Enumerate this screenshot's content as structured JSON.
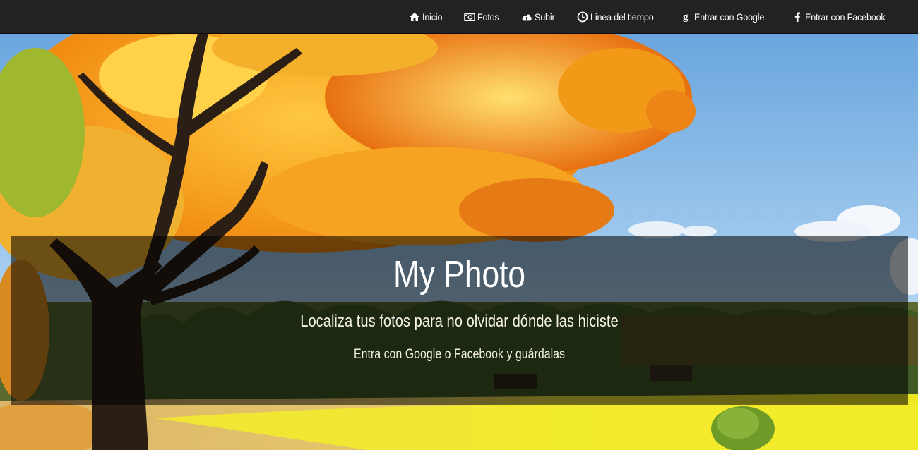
{
  "navbar": {
    "items": [
      {
        "label": "Inicio",
        "icon": "home-icon"
      },
      {
        "label": "Fotos",
        "icon": "camera-icon"
      },
      {
        "label": "Subir",
        "icon": "cloud-upload-icon"
      },
      {
        "label": "Linea del tiempo",
        "icon": "clock-icon"
      },
      {
        "label": "Entrar con Google",
        "icon": "google-plus-icon"
      },
      {
        "label": "Entrar con Facebook",
        "icon": "facebook-icon"
      }
    ]
  },
  "hero": {
    "title": "My Photo",
    "subtitle": "Localiza tus fotos para no olvidar dónde las hiciste",
    "cta": "Entra con Google o Facebook y guárdalas"
  },
  "colors": {
    "navbar_bg": "#222222",
    "nav_text": "#ffffff",
    "overlay": "rgba(0,0,0,0.55)",
    "sky": "#87b6e0",
    "foliage": "#f0a020",
    "field": "#e8e020"
  }
}
